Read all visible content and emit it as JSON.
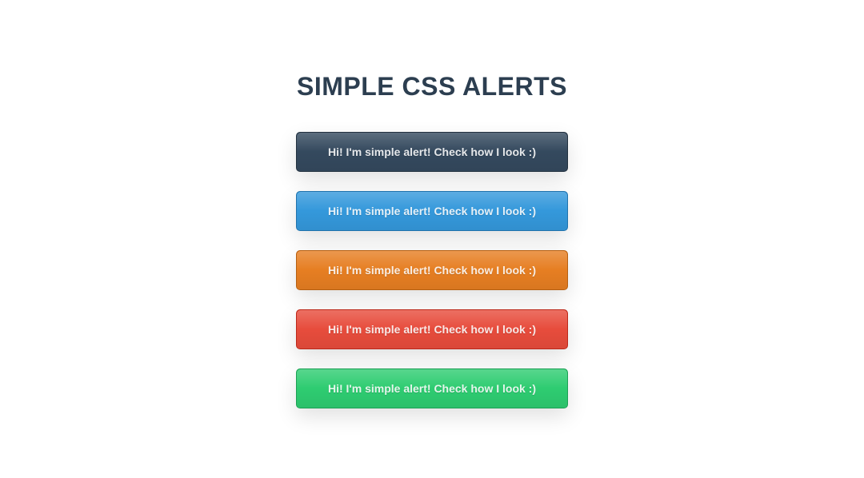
{
  "title": "SIMPLE CSS ALERTS",
  "alerts": {
    "dark": {
      "text": "Hi! I'm simple alert! Check how I look :)"
    },
    "blue": {
      "text": "Hi! I'm simple alert! Check how I look :)"
    },
    "orange": {
      "text": "Hi! I'm simple alert! Check how I look :)"
    },
    "red": {
      "text": "Hi! I'm simple alert! Check how I look :)"
    },
    "green": {
      "text": "Hi! I'm simple alert! Check how I look :)"
    }
  }
}
